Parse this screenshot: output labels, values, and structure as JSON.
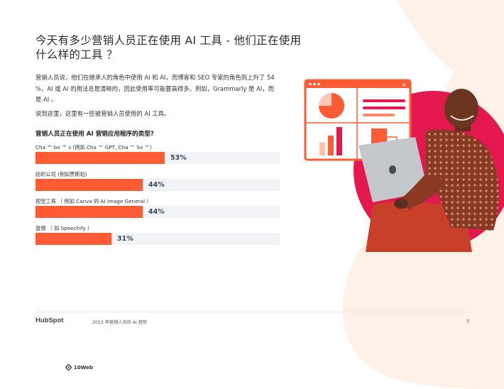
{
  "header": {
    "title": "今天有多少营销人员正在使用 AI 工具 - 他们正在使用什么样的工具 ？"
  },
  "intro": {
    "paragraph": "营销人员说，他们在继承人的角色中使用 AI 和 AI，而博客和 SEO 专家的角色则上升了 54 %，AI 或 AI 的用法总是清晰的，因此使用率可能要高得多。例如，Grammarly 是 AI，而是 AI 。",
    "paragraph2": "说到这里，这里有一些被营销人员使用的 AI 工具。"
  },
  "chart_data": {
    "type": "bar",
    "title": "营销人员正在使用 AI 营销应用程序的类型?",
    "categories": [
      "Cha ™ bo ™ s (例如 Cha ™ GPT, Cha ™ So ™)",
      "纺织公司 (例如贾斯珀)",
      "视觉工具 （ 例如 Canva 的 AI Image General ）",
      "音频 （ 如 Speechify ）"
    ],
    "values": [
      53,
      44,
      44,
      31
    ],
    "value_labels": [
      "53%",
      "44%",
      "44%",
      "31%"
    ],
    "xlim": [
      0,
      100
    ],
    "bar_color": "#ff5c35",
    "track_color": "#f2f3f6",
    "value_color": "#33475b"
  },
  "footer": {
    "logo": "HubSpot",
    "text": "2023 年营销人员的 AI 趋势",
    "page": "7",
    "brand": "10Web"
  },
  "colors": {
    "accent": "#ff5c35",
    "peach": "#fdeee4",
    "magenta": "#e4174f"
  }
}
